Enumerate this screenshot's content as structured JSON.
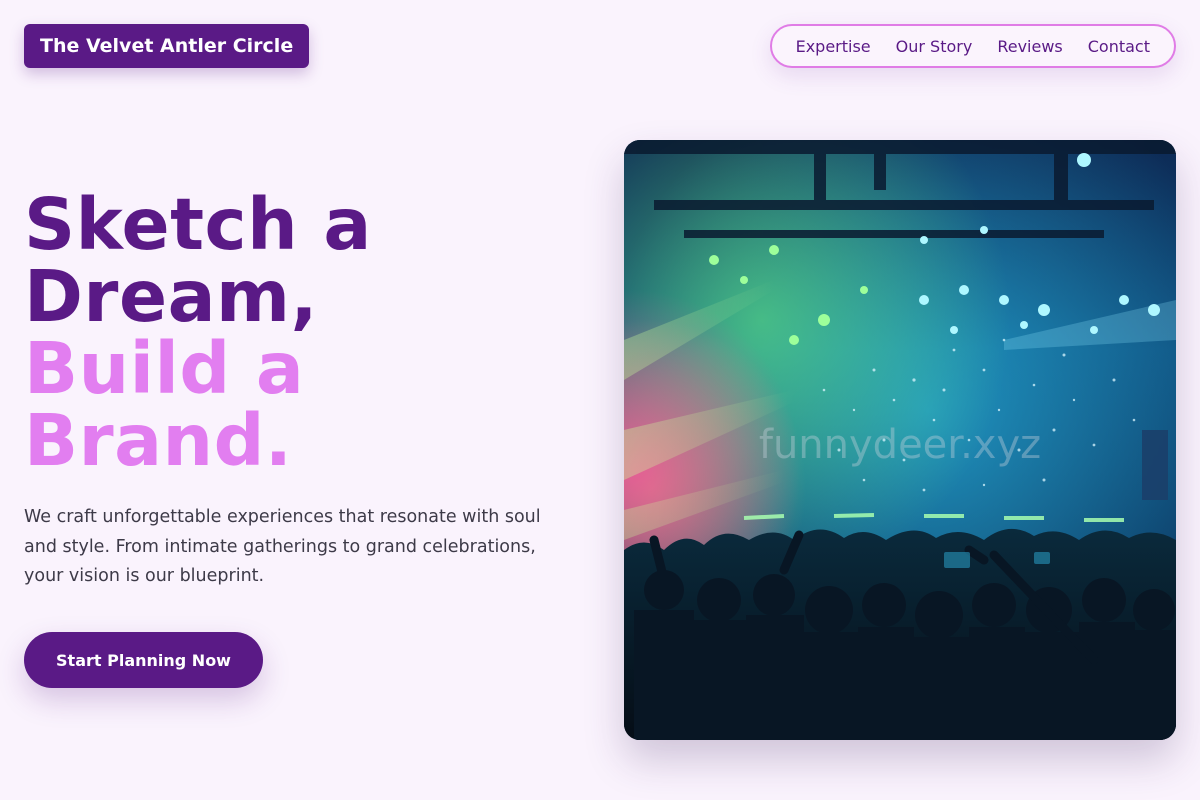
{
  "brand": {
    "logo_text": "The Velvet Antler Circle"
  },
  "nav": {
    "items": [
      {
        "label": "Expertise"
      },
      {
        "label": "Our Story"
      },
      {
        "label": "Reviews"
      },
      {
        "label": "Contact"
      }
    ]
  },
  "hero": {
    "headline_lines": [
      "Sketch a",
      "Dream,",
      "Build a",
      "Brand."
    ],
    "subtext": "We craft unforgettable experiences that resonate with soul and style. From intimate gatherings to grand celebrations, your vision is our blueprint.",
    "cta_label": "Start Planning Now",
    "image": {
      "description": "concert-crowd-with-stage-lights-and-confetti",
      "watermark": "funnydeer.xyz"
    }
  },
  "colors": {
    "background": "#faf3fd",
    "brand_purple": "#5a1a86",
    "accent_pink": "#e27ef0",
    "nav_border": "#e07ce6",
    "body_text": "#3d3a48"
  }
}
